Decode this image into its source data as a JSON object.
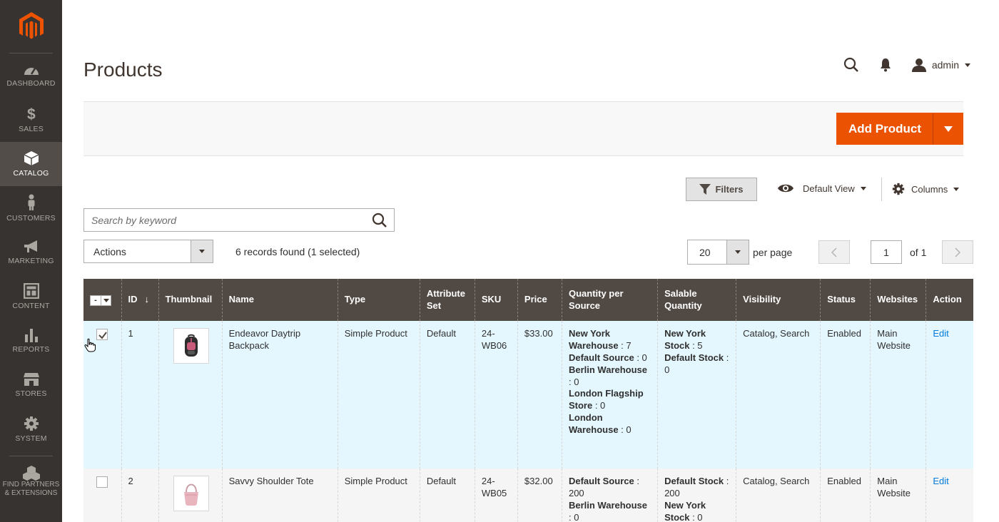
{
  "sidebar": {
    "items": [
      {
        "label": "DASHBOARD",
        "icon": "dashboard-icon"
      },
      {
        "label": "SALES",
        "icon": "dollar-icon"
      },
      {
        "label": "CATALOG",
        "icon": "box-icon",
        "active": true
      },
      {
        "label": "CUSTOMERS",
        "icon": "person-icon"
      },
      {
        "label": "MARKETING",
        "icon": "megaphone-icon"
      },
      {
        "label": "CONTENT",
        "icon": "layout-icon"
      },
      {
        "label": "REPORTS",
        "icon": "bar-chart-icon"
      },
      {
        "label": "STORES",
        "icon": "store-icon"
      },
      {
        "label": "SYSTEM",
        "icon": "gear-icon"
      }
    ],
    "partners_line1": "FIND PARTNERS",
    "partners_line2": "& EXTENSIONS"
  },
  "header": {
    "title": "Products",
    "user": "admin"
  },
  "toolbar": {
    "add_product_label": "Add Product",
    "filters_label": "Filters",
    "view_label": "Default View",
    "columns_label": "Columns"
  },
  "search": {
    "placeholder": "Search by keyword"
  },
  "mass_actions": {
    "label": "Actions",
    "records_text": "6 records found (1 selected)"
  },
  "pagination": {
    "per_page_value": "20",
    "per_page_label": "per page",
    "current_page": "1",
    "of_label": "of 1"
  },
  "grid": {
    "mass_select_symbol": "-",
    "columns": [
      "ID",
      "Thumbnail",
      "Name",
      "Type",
      "Attribute Set",
      "SKU",
      "Price",
      "Quantity per Source",
      "Salable Quantity",
      "Visibility",
      "Status",
      "Websites",
      "Action"
    ],
    "sort_arrow": "↓",
    "rows": [
      {
        "id": "1",
        "name": "Endeavor Daytrip Backpack",
        "type": "Simple Product",
        "attribute_set": "Default",
        "sku": "24-WB06",
        "price": "$33.00",
        "qty_per_source": [
          {
            "source": "New York Warehouse",
            "qty": " : 7"
          },
          {
            "source": "Default Source",
            "qty": " : 0"
          },
          {
            "source": "Berlin Warehouse",
            "qty": " : 0"
          },
          {
            "source": "London Flagship Store",
            "qty": " : 0"
          },
          {
            "source": "London Warehouse",
            "qty": " : 0"
          }
        ],
        "salable_qty": [
          {
            "stock": "New York Stock",
            "qty": " : 5"
          },
          {
            "stock": "Default Stock",
            "qty": " : 0"
          }
        ],
        "visibility": "Catalog, Search",
        "status": "Enabled",
        "websites": "Main Website",
        "action": "Edit",
        "selected": true
      },
      {
        "id": "2",
        "name": "Savvy Shoulder Tote",
        "type": "Simple Product",
        "attribute_set": "Default",
        "sku": "24-WB05",
        "price": "$32.00",
        "qty_per_source": [
          {
            "source": "Default Source",
            "qty": " : 200"
          },
          {
            "source": "Berlin Warehouse",
            "qty": " : 0"
          }
        ],
        "salable_qty": [
          {
            "stock": "Default Stock",
            "qty": " : 200"
          },
          {
            "stock": "New York Stock",
            "qty": " : 0"
          }
        ],
        "visibility": "Catalog, Search",
        "status": "Enabled",
        "websites": "Main Website",
        "action": "Edit",
        "selected": false
      }
    ]
  },
  "colors": {
    "sidebar_bg": "#373330",
    "sidebar_active": "#524d49",
    "accent": "#eb5202",
    "grid_header": "#514943",
    "selected_row": "#e5f7fe",
    "link": "#007bdb"
  }
}
